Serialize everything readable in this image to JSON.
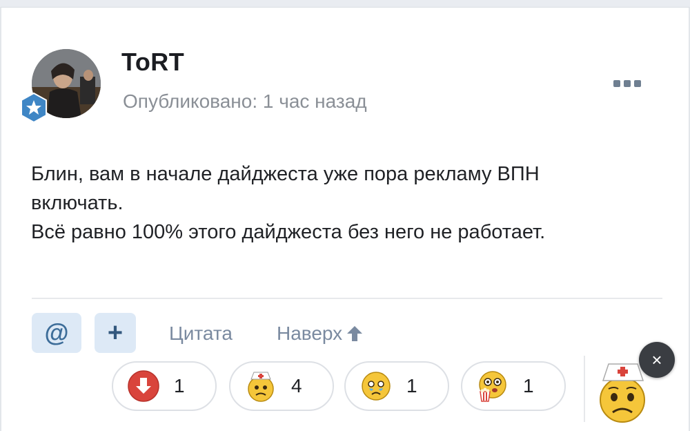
{
  "post": {
    "author": "ToRT",
    "meta": "Опубликовано: 1 час назад",
    "body_lines": [
      "Блин, вам в начале дайджеста уже пора рекламу ВПН",
      "включать.",
      "Всё равно 100% этого дайджеста без него не работает."
    ]
  },
  "actions": {
    "mention_label": "@",
    "add_label": "+",
    "quote_label": "Цитата",
    "top_label": "Наверх",
    "close_label": "×"
  },
  "reactions": [
    {
      "icon": "downvote-icon",
      "count": "1"
    },
    {
      "icon": "nurse-hat-face-icon",
      "count": "4"
    },
    {
      "icon": "crying-face-icon",
      "count": "1"
    },
    {
      "icon": "popcorn-face-icon",
      "count": "1"
    }
  ],
  "colors": {
    "accent": "#3d6d99",
    "button_bg": "#dde9f6",
    "muted_text": "#8a8f96",
    "downvote_red": "#d9443c",
    "badge_blue": "#3f86c5"
  }
}
